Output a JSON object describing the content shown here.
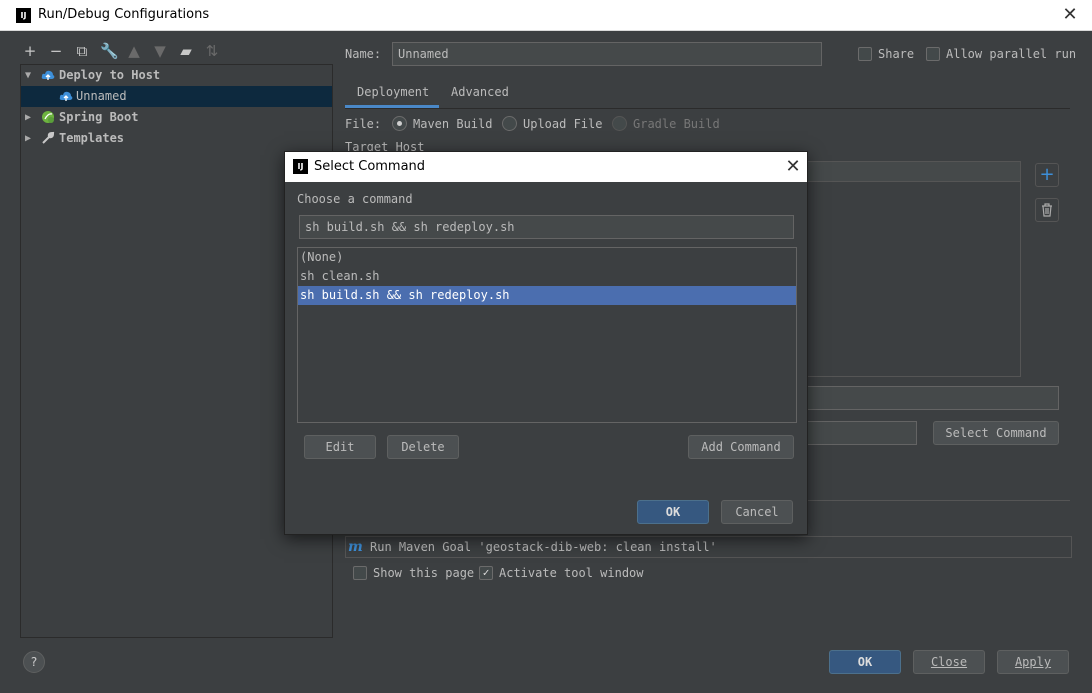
{
  "window": {
    "title": "Run/Debug Configurations",
    "logo": "IJ"
  },
  "toolbar": {
    "icons": [
      "plus-icon",
      "minus-icon",
      "copy-icon",
      "wrench-icon",
      "arrow-up-icon",
      "arrow-down-icon",
      "folder-icon",
      "sort-icon"
    ]
  },
  "tree": {
    "items": [
      {
        "label": "Deploy to Host",
        "expanded": true,
        "icon": "cloud-icon"
      },
      {
        "label": "Unnamed",
        "selected": true,
        "icon": "cloud-icon"
      },
      {
        "label": "Spring Boot",
        "expanded": false,
        "icon": "spring-icon"
      },
      {
        "label": "Templates",
        "expanded": false,
        "icon": "wrench-icon"
      }
    ]
  },
  "config": {
    "name_label": "Name:",
    "name_value": "Unnamed",
    "share_label": "Share",
    "parallel_label": "Allow parallel run",
    "tabs": [
      "Deployment",
      "Advanced"
    ],
    "file_label": "File:",
    "file_options": [
      "Maven Build",
      "Upload File",
      "Gradle Build"
    ],
    "target_host_label": "Target Host",
    "select_command_button": "Select Command",
    "before_launch_task": "Run Maven Goal 'geostack-dib-web: clean install'",
    "show_this_page_label": "Show this page",
    "activate_tool_window_label": "Activate tool window"
  },
  "footer": {
    "ok": "OK",
    "close": "Close",
    "apply": "Apply",
    "help": "?"
  },
  "dialog": {
    "title": "Select Command",
    "logo": "IJ",
    "prompt": "Choose a command",
    "current_value": "sh build.sh && sh redeploy.sh",
    "commands": [
      "(None)",
      "sh clean.sh",
      "sh build.sh && sh redeploy.sh"
    ],
    "selected_index": 2,
    "edit": "Edit",
    "delete": "Delete",
    "add_command": "Add Command",
    "ok": "OK",
    "cancel": "Cancel"
  },
  "colors": {
    "background": "#3c3f41",
    "selection": "#4b6eaf",
    "primary_button": "#365880",
    "tree_selection": "#0d293e"
  }
}
